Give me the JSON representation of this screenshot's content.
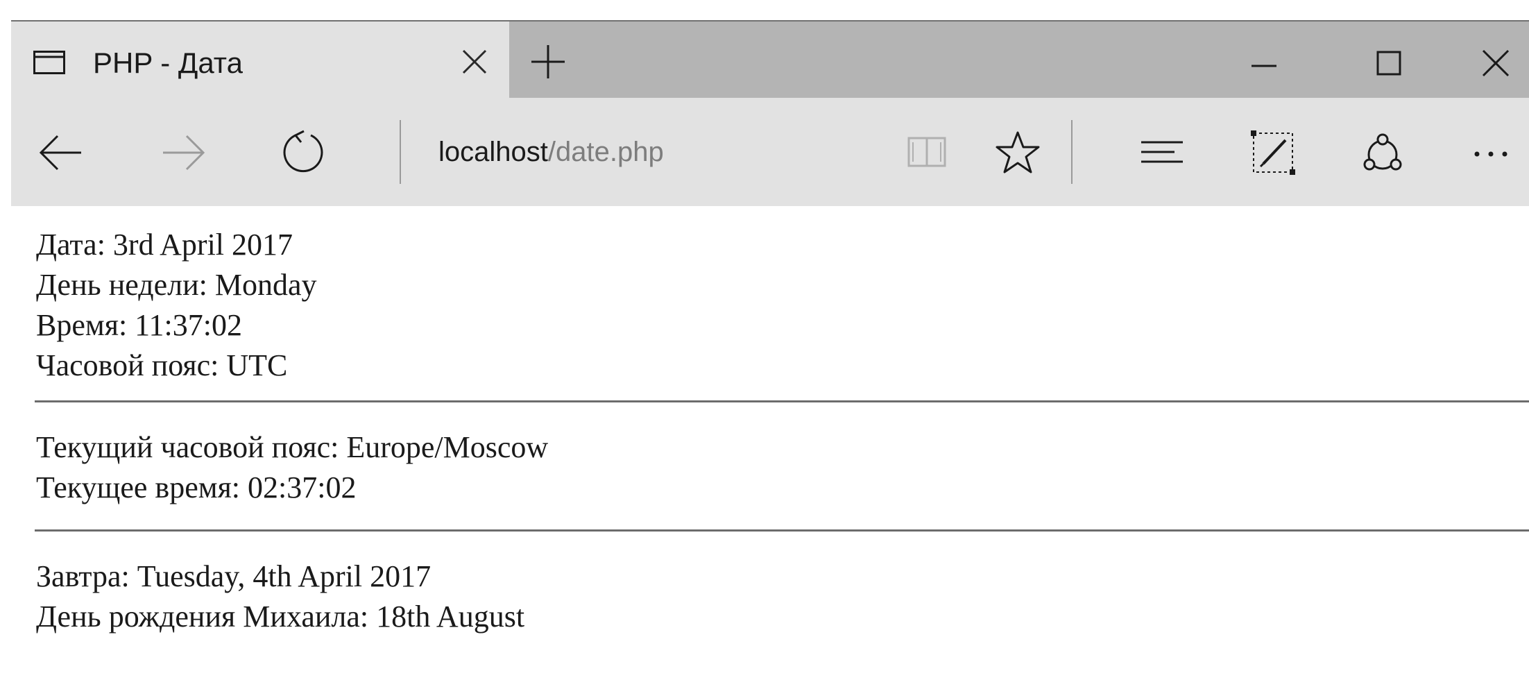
{
  "browser": {
    "tab": {
      "title": "PHP - Дата"
    },
    "address": {
      "host": "localhost",
      "path": "/date.php"
    }
  },
  "page": {
    "block1": [
      "Дата: 3rd April 2017",
      "День недели: Monday",
      "Время: 11:37:02",
      "Часовой пояс: UTC"
    ],
    "block2": [
      "Текущий часовой пояс: Europe/Moscow",
      "Текущее время: 02:37:02"
    ],
    "block3": [
      "Завтра: Tuesday, 4th April 2017",
      "День рождения Михаила: 18th August"
    ]
  },
  "icons": {
    "tab": "tab-page-icon",
    "tab_close": "close-icon",
    "new_tab": "plus-icon",
    "minimize": "minimize-icon",
    "maximize": "maximize-icon",
    "close_window": "close-icon",
    "back": "back-arrow-icon",
    "forward": "forward-arrow-icon",
    "refresh": "refresh-icon",
    "reading_view": "book-icon",
    "favorite": "star-icon",
    "hub": "hub-icon",
    "web_note": "pen-note-icon",
    "share": "share-icon",
    "more": "more-icon"
  },
  "colors": {
    "tabstrip": "#b4b4b4",
    "active_tab": "#e2e2e2",
    "url_path": "#7d7d7d"
  }
}
